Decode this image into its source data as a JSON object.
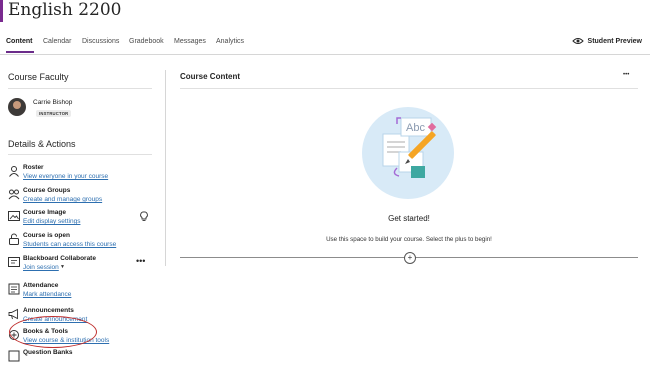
{
  "course": {
    "title": "English 2200"
  },
  "nav": {
    "tabs": [
      "Content",
      "Calendar",
      "Discussions",
      "Gradebook",
      "Messages",
      "Analytics"
    ],
    "student_preview": "Student Preview"
  },
  "sidebar": {
    "faculty_heading": "Course Faculty",
    "faculty": {
      "name": "Carrie Bishop",
      "role": "INSTRUCTOR"
    },
    "details_heading": "Details & Actions",
    "actions": [
      {
        "title": "Roster",
        "link": "View everyone in your course",
        "icon": "roster-icon"
      },
      {
        "title": "Course Groups",
        "link": "Create and manage groups",
        "icon": "groups-icon"
      },
      {
        "title": "Course Image",
        "link": "Edit display settings",
        "icon": "image-icon"
      },
      {
        "title": "Course is open",
        "link": "Students can access this course",
        "icon": "unlock-icon"
      },
      {
        "title": "Blackboard Collaborate",
        "link": "Join session",
        "icon": "collaborate-icon"
      },
      {
        "title": "Attendance",
        "link": "Mark attendance",
        "icon": "attendance-icon"
      },
      {
        "title": "Announcements",
        "link": "Create announcement",
        "icon": "megaphone-icon"
      },
      {
        "title": "Books & Tools",
        "link": "View course & institution tools",
        "icon": "tools-icon"
      },
      {
        "title": "Question Banks",
        "link": "",
        "icon": "question-bank-icon"
      }
    ]
  },
  "main": {
    "heading": "Course Content",
    "get_started": "Get started!",
    "use_space": "Use this space to build your course. Select the plus to begin!"
  },
  "colors": {
    "accent": "#7a2a8f",
    "link": "#2d6fb0",
    "annotation": "#c0302f"
  }
}
